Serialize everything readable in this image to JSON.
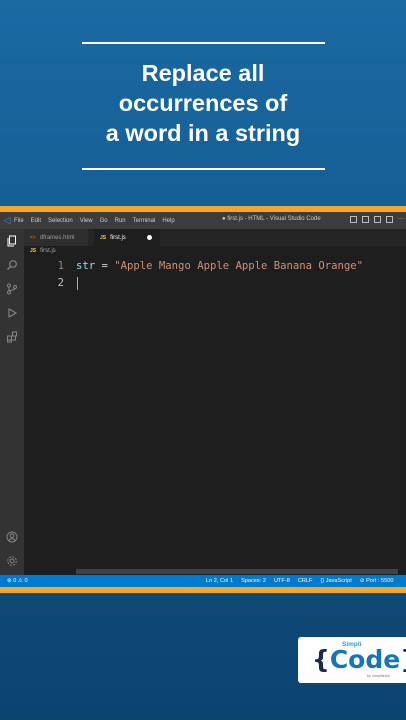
{
  "slide": {
    "title_lines": [
      "Replace all",
      "occurrences of",
      "a word in a string"
    ]
  },
  "vscode": {
    "menu": [
      "File",
      "Edit",
      "Selection",
      "View",
      "Go",
      "Run",
      "Terminal",
      "Help"
    ],
    "window_title": "● first.js - HTML - Visual Studio Code",
    "tabs": [
      {
        "label": "dframes.html",
        "icon": "<>",
        "active": false
      },
      {
        "label": "first.js",
        "icon": "JS",
        "active": true,
        "unsaved": true
      }
    ],
    "breadcrumb": {
      "icon": "JS",
      "label": "first.js"
    },
    "editor": {
      "lines": [
        {
          "number": "1",
          "var": "str",
          "op": " = ",
          "string": "\"Apple Mango Apple Apple Banana Orange\""
        },
        {
          "number": "2"
        }
      ]
    },
    "status_bar": {
      "problems": "⊗ 0 ⚠ 0",
      "position": "Ln 2, Col 1",
      "spaces": "Spaces: 2",
      "encoding": "UTF-8",
      "eol": "CRLF",
      "language": "{} JavaScript",
      "port": "⊘ Port : 5500"
    }
  },
  "logo": {
    "simpli": "Simpli",
    "code_open": "{",
    "code": "Code",
    "code_close": "}",
    "by": "by simplilearn"
  },
  "colors": {
    "background": "#145c92",
    "accent_orange": "#f4a52a",
    "editor_bg": "#1e1e1e",
    "status_bar": "#007acc",
    "string": "#ce9178",
    "variable": "#9cdcfe"
  },
  "icons": [
    "files-icon",
    "search-icon",
    "source-control-icon",
    "run-debug-icon",
    "extensions-icon",
    "account-icon",
    "settings-gear-icon"
  ]
}
